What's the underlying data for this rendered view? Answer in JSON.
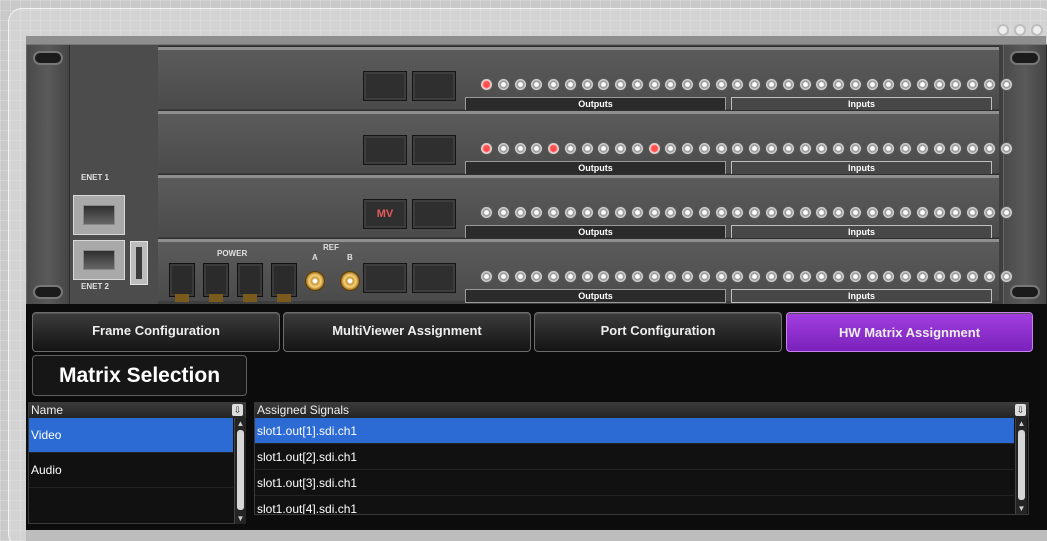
{
  "window": {
    "controls": [
      "circle",
      "circle",
      "circle"
    ]
  },
  "chassis": {
    "slots": [
      {
        "outputs_label": "Outputs",
        "inputs_label": "Inputs",
        "block_label": "",
        "red_connectors": [
          0
        ]
      },
      {
        "outputs_label": "Outputs",
        "inputs_label": "Inputs",
        "block_label": "",
        "red_connectors": [
          0,
          4,
          10
        ]
      },
      {
        "outputs_label": "Outputs",
        "inputs_label": "Inputs",
        "block_label": "MV",
        "red_connectors": []
      },
      {
        "outputs_label": "Outputs",
        "inputs_label": "Inputs",
        "block_label": "",
        "red_connectors": []
      }
    ],
    "connectors_per_slot": 32,
    "enet1_label": "ENET 1",
    "enet2_label": "ENET 2",
    "power_label": "POWER",
    "ref_label": "REF",
    "ref_a_label": "A",
    "ref_b_label": "B"
  },
  "tabs": [
    {
      "label": "Frame Configuration",
      "active": false
    },
    {
      "label": "MultiViewer Assignment",
      "active": false
    },
    {
      "label": "Port Configuration",
      "active": false
    },
    {
      "label": "HW Matrix Assignment",
      "active": true
    }
  ],
  "matrix_selection": {
    "title": "Matrix Selection",
    "name_header": "Name",
    "items": [
      {
        "label": "Video",
        "selected": true
      },
      {
        "label": "Audio",
        "selected": false
      }
    ]
  },
  "assigned": {
    "header": "Assigned Signals",
    "rows": [
      {
        "label": "slot1.out[1].sdi.ch1",
        "selected": true
      },
      {
        "label": "slot1.out[2].sdi.ch1",
        "selected": false
      },
      {
        "label": "slot1.out[3].sdi.ch1",
        "selected": false
      },
      {
        "label": "slot1.out[4].sdi.ch1",
        "selected": false
      }
    ]
  },
  "colors": {
    "accent": "#8f33d6",
    "selection": "#2b6bd3"
  }
}
